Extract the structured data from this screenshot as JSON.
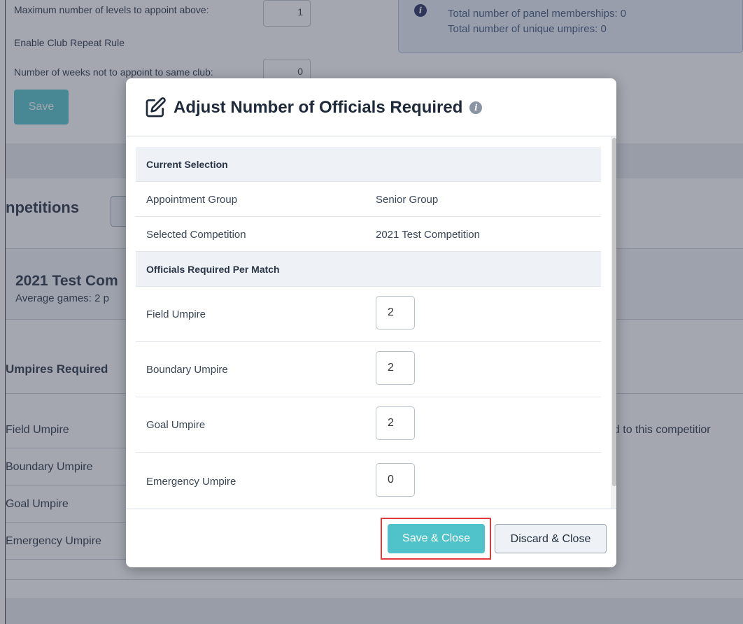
{
  "background": {
    "max_levels_label": "Maximum number of levels to appoint above:",
    "max_levels_value": "1",
    "club_repeat_label": "Enable Club Repeat Rule",
    "weeks_label": "Number of weeks not to appoint to same club:",
    "weeks_value": "0",
    "save_label": "Save",
    "info_line1": "Total number of panel memberships: 0",
    "info_line2": "Total number of unique umpires: 0",
    "competitions_heading": "npetitions",
    "competition_name": "2021 Test Com",
    "average_games": "Average games: 2 p",
    "umpires_required": "Umpires Required",
    "umpire_rows": [
      "Field Umpire",
      "Boundary Umpire",
      "Goal Umpire",
      "Emergency Umpire"
    ],
    "assigned_text": "ed to this competitior"
  },
  "modal": {
    "title": "Adjust Number of Officials Required",
    "current_selection_header": "Current Selection",
    "selection_rows": [
      {
        "label": "Appointment Group",
        "value": "Senior Group"
      },
      {
        "label": "Selected Competition",
        "value": "2021 Test Competition"
      }
    ],
    "officials_header": "Officials Required Per Match",
    "officials": [
      {
        "label": "Field Umpire",
        "value": "2"
      },
      {
        "label": "Boundary Umpire",
        "value": "2"
      },
      {
        "label": "Goal Umpire",
        "value": "2"
      },
      {
        "label": "Emergency Umpire",
        "value": "0"
      }
    ],
    "save_close_label": "Save & Close",
    "discard_close_label": "Discard & Close"
  },
  "colors": {
    "accent": "#4fc3c9",
    "highlight": "#e03a3a"
  }
}
